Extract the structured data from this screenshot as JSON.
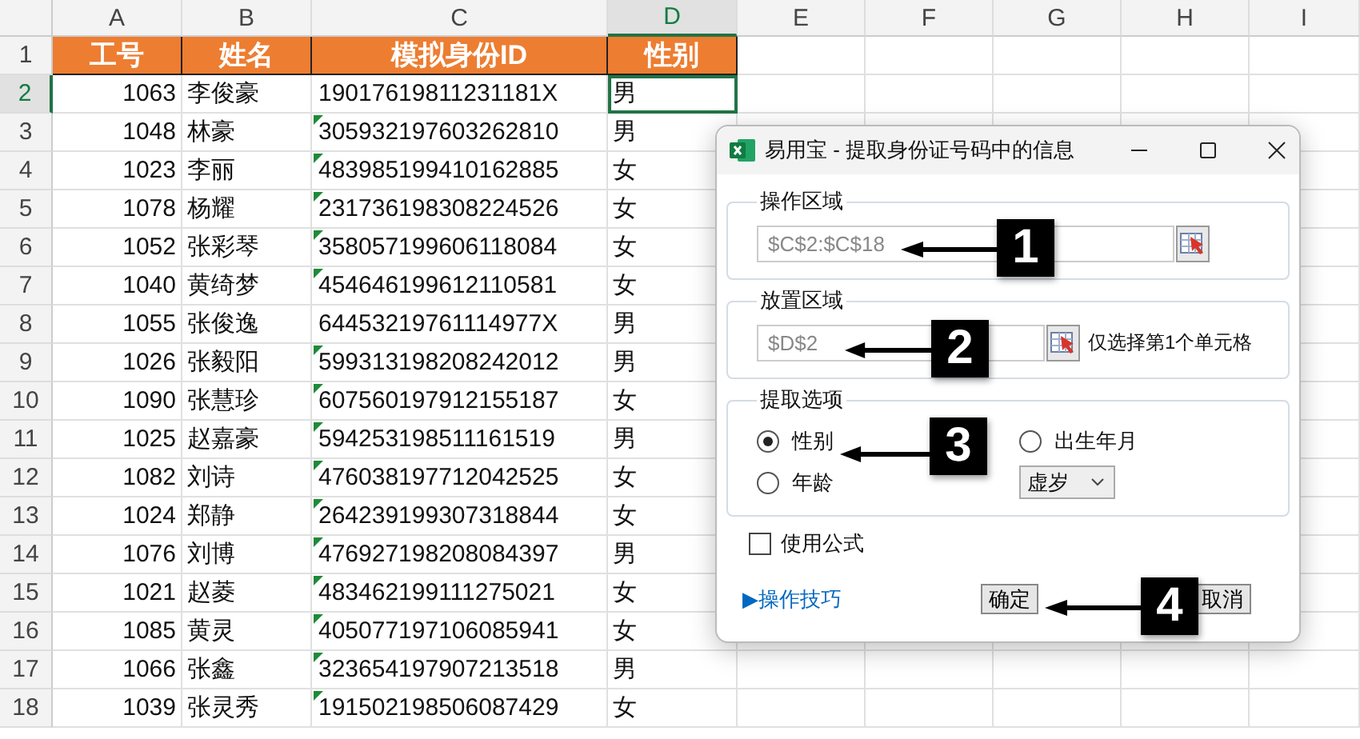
{
  "sheet": {
    "columns": [
      {
        "label": "A",
        "selected": false
      },
      {
        "label": "B",
        "selected": false
      },
      {
        "label": "C",
        "selected": false
      },
      {
        "label": "D",
        "selected": true
      },
      {
        "label": "E",
        "selected": false
      },
      {
        "label": "F",
        "selected": false
      },
      {
        "label": "G",
        "selected": false
      },
      {
        "label": "H",
        "selected": false
      },
      {
        "label": "I",
        "selected": false
      }
    ],
    "header_row": {
      "number": "1",
      "cells": [
        "工号",
        "姓名",
        "模拟身份ID",
        "性别"
      ]
    },
    "rows": [
      {
        "number": "2",
        "selected": true,
        "cells": [
          "1063",
          "李俊豪",
          "19017619811231181X",
          "男"
        ],
        "text_warning": false
      },
      {
        "number": "3",
        "selected": false,
        "cells": [
          "1048",
          "林豪",
          "305932197603262810",
          "男"
        ],
        "text_warning": true
      },
      {
        "number": "4",
        "selected": false,
        "cells": [
          "1023",
          "李丽",
          "483985199410162885",
          "女"
        ],
        "text_warning": true
      },
      {
        "number": "5",
        "selected": false,
        "cells": [
          "1078",
          "杨耀",
          "231736198308224526",
          "女"
        ],
        "text_warning": true
      },
      {
        "number": "6",
        "selected": false,
        "cells": [
          "1052",
          "张彩琴",
          "358057199606118084",
          "女"
        ],
        "text_warning": true
      },
      {
        "number": "7",
        "selected": false,
        "cells": [
          "1040",
          "黄绮梦",
          "454646199612110581",
          "女"
        ],
        "text_warning": true
      },
      {
        "number": "8",
        "selected": false,
        "cells": [
          "1055",
          "张俊逸",
          "64453219761114977X",
          "男"
        ],
        "text_warning": false
      },
      {
        "number": "9",
        "selected": false,
        "cells": [
          "1026",
          "张毅阳",
          "599313198208242012",
          "男"
        ],
        "text_warning": true
      },
      {
        "number": "10",
        "selected": false,
        "cells": [
          "1090",
          "张慧珍",
          "607560197912155187",
          "女"
        ],
        "text_warning": true
      },
      {
        "number": "11",
        "selected": false,
        "cells": [
          "1025",
          "赵嘉豪",
          "594253198511161519",
          "男"
        ],
        "text_warning": true
      },
      {
        "number": "12",
        "selected": false,
        "cells": [
          "1082",
          "刘诗",
          "476038197712042525",
          "女"
        ],
        "text_warning": true
      },
      {
        "number": "13",
        "selected": false,
        "cells": [
          "1024",
          "郑静",
          "264239199307318844",
          "女"
        ],
        "text_warning": true
      },
      {
        "number": "14",
        "selected": false,
        "cells": [
          "1076",
          "刘博",
          "476927198208084397",
          "男"
        ],
        "text_warning": true
      },
      {
        "number": "15",
        "selected": false,
        "cells": [
          "1021",
          "赵菱",
          "483462199111275021",
          "女"
        ],
        "text_warning": true
      },
      {
        "number": "16",
        "selected": false,
        "cells": [
          "1085",
          "黄灵",
          "405077197106085941",
          "女"
        ],
        "text_warning": true
      },
      {
        "number": "17",
        "selected": false,
        "cells": [
          "1066",
          "张鑫",
          "323654197907213518",
          "男"
        ],
        "text_warning": true
      },
      {
        "number": "18",
        "selected": false,
        "cells": [
          "1039",
          "张灵秀",
          "191502198506087429",
          "女"
        ],
        "text_warning": true
      }
    ]
  },
  "dialog": {
    "title": "易用宝 - 提取身份证号码中的信息",
    "operation_area": {
      "label": "操作区域",
      "value": "$C$2:$C$18"
    },
    "output_area": {
      "label": "放置区域",
      "value": "$D$2",
      "note": "仅选择第1个单元格"
    },
    "extract_options": {
      "label": "提取选项",
      "options": [
        {
          "label": "性别",
          "selected": true
        },
        {
          "label": "出生年月",
          "selected": false
        },
        {
          "label": "年龄",
          "selected": false
        }
      ],
      "age_type": "虚岁"
    },
    "use_formula": {
      "label": "使用公式",
      "checked": false
    },
    "tips_link": "▶操作技巧",
    "buttons": [
      "确定",
      "取消"
    ]
  },
  "callouts": [
    {
      "label": "1"
    },
    {
      "label": "2"
    },
    {
      "label": "3"
    },
    {
      "label": "4"
    }
  ]
}
